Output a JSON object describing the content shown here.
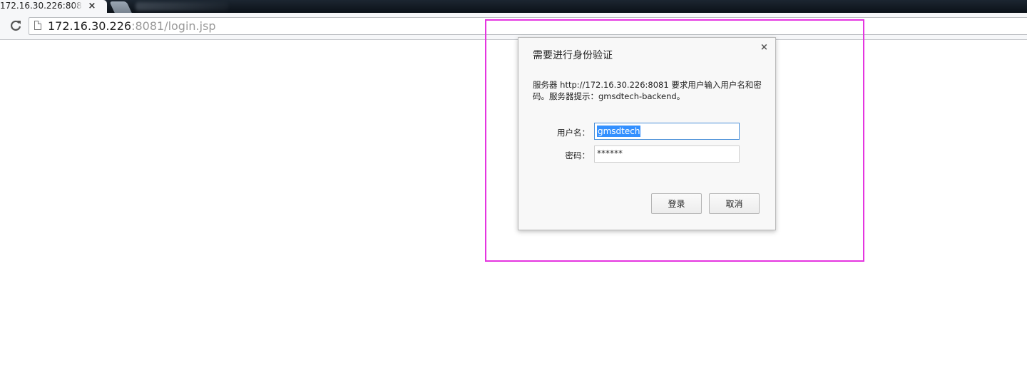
{
  "browser": {
    "tab": {
      "title": "172.16.30.226:8081/login.jsp",
      "close_symbol": "×"
    },
    "address": {
      "host": "172.16.30.226",
      "rest": ":8081/login.jsp"
    },
    "reload_symbol": "C"
  },
  "auth_dialog": {
    "title": "需要进行身份验证",
    "close_symbol": "×",
    "message": "服务器 http://172.16.30.226:8081 要求用户输入用户名和密码。服务器提示：gmsdtech-backend。",
    "username_label": "用户名：",
    "username_value": "gmsdtech",
    "password_label": "密码：",
    "password_value": "******",
    "login_button": "登录",
    "cancel_button": "取消"
  },
  "colors": {
    "highlight_border": "#e535e0",
    "selection": "#3390ff",
    "focus_border": "#4a90d9"
  }
}
